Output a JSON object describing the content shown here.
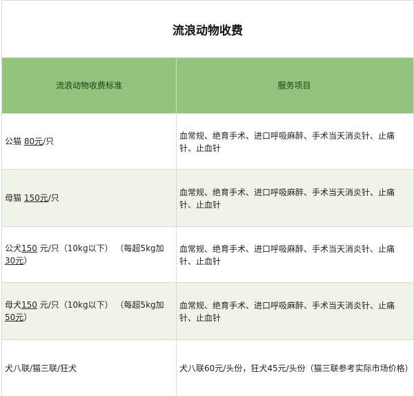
{
  "title": "流浪动物收费",
  "headers": {
    "standard": "流浪动物收费标准",
    "services": "服务项目"
  },
  "rows": [
    {
      "std_a": "公猫 ",
      "std_num": "80元",
      "std_b": "/只",
      "services": "血常规、绝育手术、进口呼吸麻醉、手术当天消炎针、止痛针、止血针"
    },
    {
      "std_a": "母猫 ",
      "std_num": "150元",
      "std_b": "/只",
      "services": "血常规、绝育手术、进口呼吸麻醉、手术当天消炎针、止痛针、止血针"
    },
    {
      "std_a": "公犬",
      "std_num": "150",
      "std_b": " 元/只（10kg以下）  （每超5kg加",
      "std_num2": "30元",
      "std_c": "）",
      "services": "血常规、绝育手术、进口呼吸麻醉、手术当天消炎针、止痛针、止血针"
    },
    {
      "std_a": "母犬",
      "std_num": "150",
      "std_b": " 元/只（10kg以下）  （每超5kg加",
      "std_num2": "50元",
      "std_c": "）",
      "services": "血常规、绝育手术、进口呼吸麻醉、手术当天消炎针、止痛针、止血针"
    },
    {
      "std_a": "犬八联/猫三联/狂犬",
      "services": "犬八联60元/头份，狂犬45元/头份（猫三联参考实际市场价格）"
    }
  ]
}
